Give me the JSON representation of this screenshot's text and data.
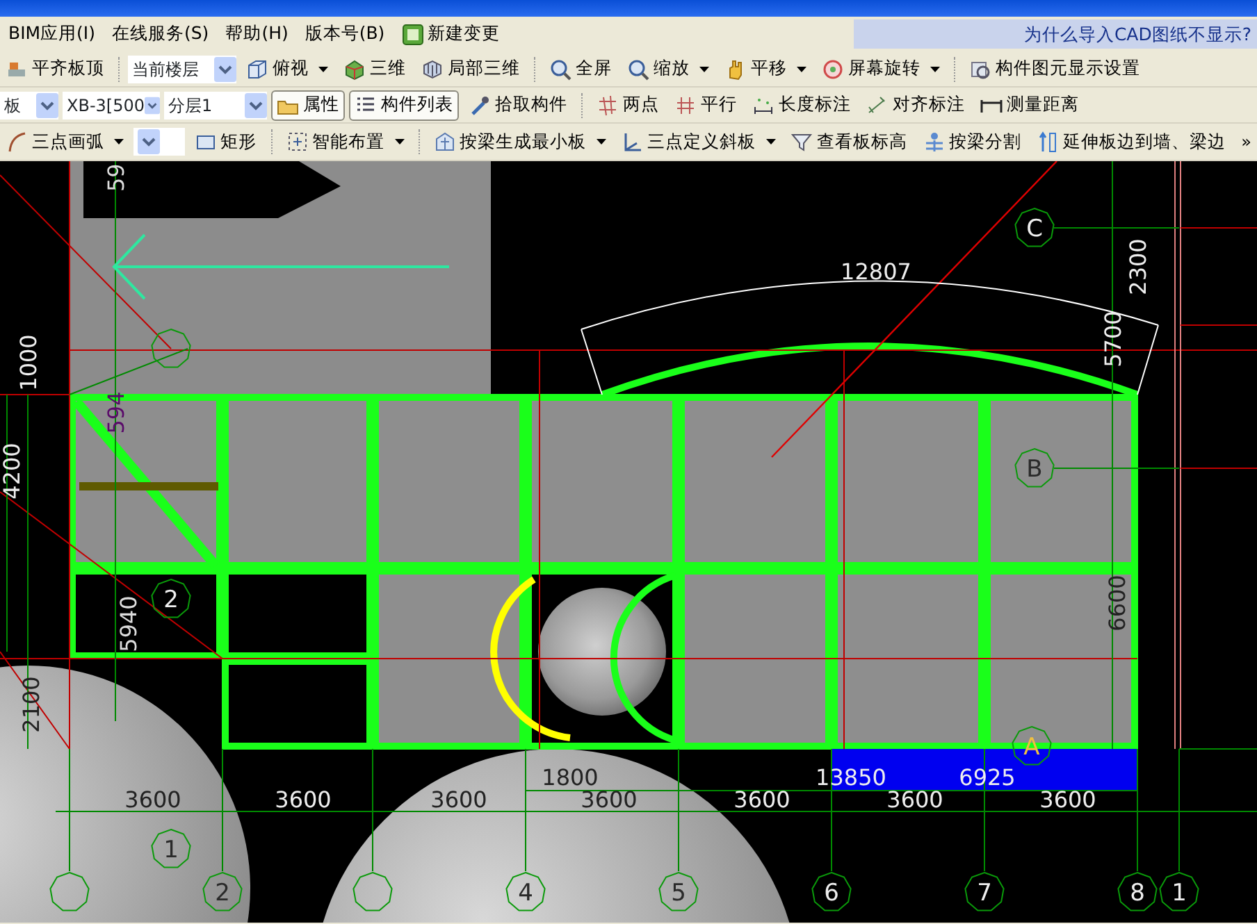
{
  "menu_bar": {
    "items": [
      "BIM应用(I)",
      "在线服务(S)",
      "帮助(H)",
      "版本号(B)"
    ],
    "new_change_button": "新建变更",
    "help_link": "为什么导入CAD图纸不显示?"
  },
  "toolbars": [
    {
      "items": [
        {
          "kind": "button",
          "label": "平齐板顶"
        },
        {
          "kind": "separator"
        },
        {
          "kind": "select",
          "value": "当前楼层"
        },
        {
          "kind": "dropdown",
          "label": "俯视"
        },
        {
          "kind": "button",
          "label": "三维"
        },
        {
          "kind": "button",
          "label": "局部三维"
        },
        {
          "kind": "separator"
        },
        {
          "kind": "button",
          "label": "全屏"
        },
        {
          "kind": "dropdown",
          "label": "缩放"
        },
        {
          "kind": "dropdown",
          "label": "平移"
        },
        {
          "kind": "dropdown",
          "label": "屏幕旋转"
        },
        {
          "kind": "separator"
        },
        {
          "kind": "button",
          "label": "构件图元显示设置"
        }
      ]
    },
    {
      "items": [
        {
          "kind": "select",
          "value": "板"
        },
        {
          "kind": "select",
          "value": "XB-3[500"
        },
        {
          "kind": "select",
          "value": "分层1"
        },
        {
          "kind": "toggle",
          "label": "属性",
          "pressed": true
        },
        {
          "kind": "toggle",
          "label": "构件列表",
          "pressed": true
        },
        {
          "kind": "button",
          "label": "拾取构件"
        },
        {
          "kind": "separator"
        },
        {
          "kind": "button",
          "label": "两点"
        },
        {
          "kind": "button",
          "label": "平行"
        },
        {
          "kind": "button",
          "label": "长度标注"
        },
        {
          "kind": "button",
          "label": "对齐标注"
        },
        {
          "kind": "button",
          "label": "测量距离"
        }
      ]
    },
    {
      "items": [
        {
          "kind": "dropdown",
          "label": "三点画弧"
        },
        {
          "kind": "select",
          "value": ""
        },
        {
          "kind": "button",
          "label": "矩形"
        },
        {
          "kind": "separator"
        },
        {
          "kind": "dropdown",
          "label": "智能布置"
        },
        {
          "kind": "separator"
        },
        {
          "kind": "dropdown",
          "label": "按梁生成最小板"
        },
        {
          "kind": "dropdown",
          "label": "三点定义斜板"
        },
        {
          "kind": "button",
          "label": "查看板标高"
        },
        {
          "kind": "button",
          "label": "按梁分割"
        },
        {
          "kind": "button",
          "label": "延伸板边到墙、梁边"
        }
      ],
      "overflow": "»"
    }
  ],
  "canvas": {
    "dimension_labels": [
      "59",
      "12807",
      "2300",
      "1000",
      "5700",
      "594",
      "4200",
      "6600",
      "5940",
      "2100",
      "1800",
      "13850",
      "6925",
      "3600",
      "3600",
      "3600",
      "3600",
      "3600",
      "3600",
      "3600"
    ],
    "axis_labels": [
      "C",
      "B",
      "2",
      "A",
      "1",
      "2",
      "4",
      "5",
      "6",
      "7",
      "8",
      "1"
    ]
  }
}
